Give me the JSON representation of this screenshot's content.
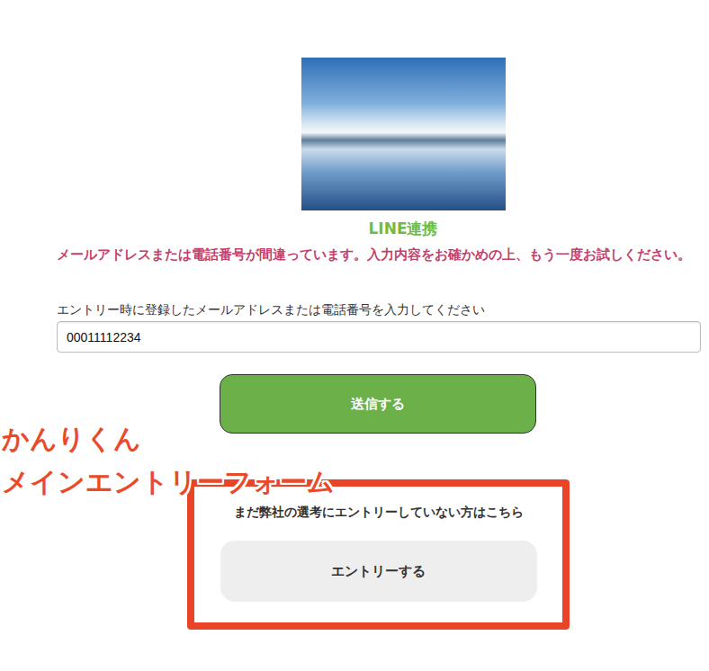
{
  "header": {
    "title": "LINE連携"
  },
  "error": "メールアドレスまたは電話番号が間違っています。入力内容をお確かめの上、もう一度お試しください。",
  "form": {
    "label": "エントリー時に登録したメールアドレスまたは電話番号を入力してください",
    "value": "00011112234",
    "submit": "送信する"
  },
  "entry": {
    "prompt": "まだ弊社の選考にエントリーしていない方はこちら",
    "button": "エントリーする"
  },
  "annotation": {
    "lines": [
      "かんりくん",
      "メインエントリーフォーム"
    ]
  }
}
